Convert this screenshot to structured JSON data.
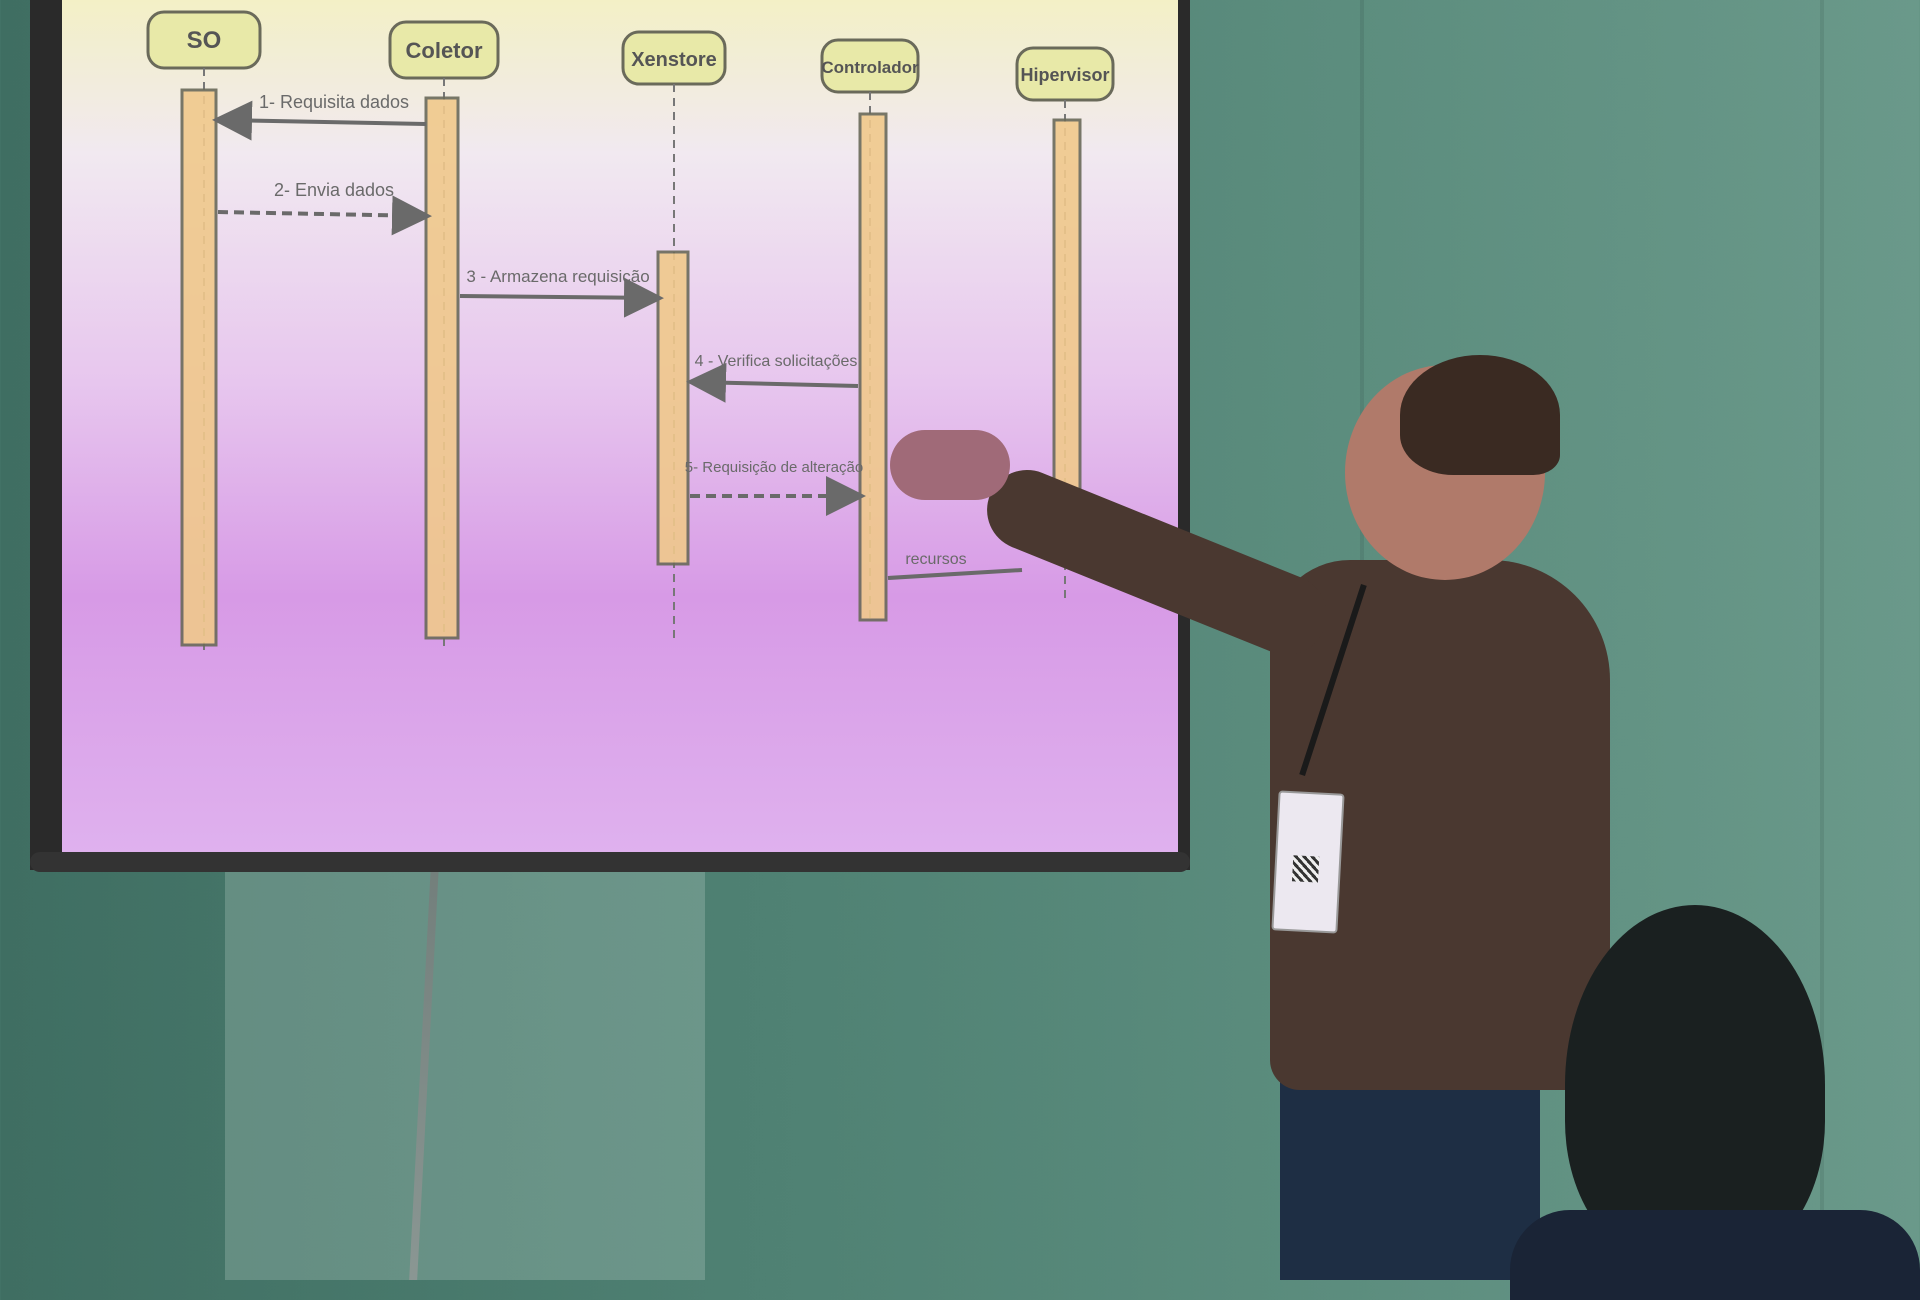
{
  "diagram": {
    "participants": [
      {
        "key": "so",
        "label": "SO"
      },
      {
        "key": "coletor",
        "label": "Coletor"
      },
      {
        "key": "xenstore",
        "label": "Xenstore"
      },
      {
        "key": "controlador",
        "label": "Controlador"
      },
      {
        "key": "hipervisor",
        "label": "Hipervisor"
      }
    ],
    "messages": [
      {
        "label": "1- Requisita dados",
        "style": "solid"
      },
      {
        "label": "2- Envia dados",
        "style": "dashed"
      },
      {
        "label": "3 - Armazena requisição",
        "style": "solid"
      },
      {
        "label": "4 - Verifica solicitações",
        "style": "solid"
      },
      {
        "label": "5- Requisição de alteração",
        "style": "dashed"
      },
      {
        "label": "recursos",
        "style": "solid"
      }
    ]
  },
  "colors": {
    "box_fill": "#e8e9a8",
    "box_stroke": "#6a6a5a",
    "lifeline_fill": "#f0c98c",
    "arrow": "#6a6a6a"
  }
}
